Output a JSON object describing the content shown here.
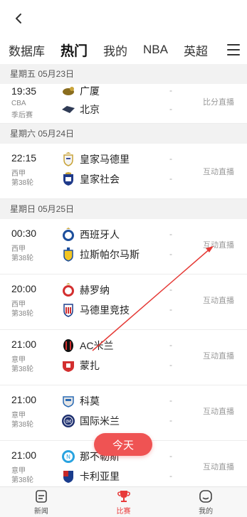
{
  "tabs": [
    "数据库",
    "热门",
    "我的",
    "NBA",
    "英超"
  ],
  "active_tab": "热门",
  "sections": [
    {
      "date": "星期五  05月23日",
      "matches": [
        {
          "time": "19:35",
          "league": "CBA",
          "round": "季后赛",
          "home": "广厦",
          "away": "北京",
          "home_score": "-",
          "away_score": "-",
          "live": "比分直播"
        }
      ]
    },
    {
      "date": "星期六  05月24日",
      "matches": [
        {
          "time": "22:15",
          "league": "西甲",
          "round": "第38轮",
          "home": "皇家马德里",
          "away": "皇家社会",
          "home_score": "-",
          "away_score": "-",
          "live": "互动直播"
        }
      ]
    },
    {
      "date": "星期日  05月25日",
      "matches": [
        {
          "time": "00:30",
          "league": "西甲",
          "round": "第38轮",
          "home": "西班牙人",
          "away": "拉斯帕尔马斯",
          "home_score": "-",
          "away_score": "-",
          "live": "互动直播"
        },
        {
          "time": "20:00",
          "league": "西甲",
          "round": "第38轮",
          "home": "赫罗纳",
          "away": "马德里竞技",
          "home_score": "-",
          "away_score": "-",
          "live": "互动直播"
        },
        {
          "time": "21:00",
          "league": "意甲",
          "round": "第38轮",
          "home": "AC米兰",
          "away": "蒙扎",
          "home_score": "-",
          "away_score": "-",
          "live": "互动直播"
        },
        {
          "time": "21:00",
          "league": "意甲",
          "round": "第38轮",
          "home": "科莫",
          "away": "国际米兰",
          "home_score": "-",
          "away_score": "-",
          "live": "互动直播"
        },
        {
          "time": "21:00",
          "league": "意甲",
          "round": "第38轮",
          "home": "那不勒斯",
          "away": "卡利亚里",
          "home_score": "-",
          "away_score": "-",
          "live": "互动直播"
        }
      ]
    }
  ],
  "today_button": "今天",
  "bottom_nav": [
    {
      "label": "新闻",
      "icon": "news-icon"
    },
    {
      "label": "比赛",
      "icon": "trophy-icon"
    },
    {
      "label": "我的",
      "icon": "profile-icon"
    }
  ],
  "colors": {
    "accent": "#e83a3a",
    "today_button": "#ef5353"
  }
}
